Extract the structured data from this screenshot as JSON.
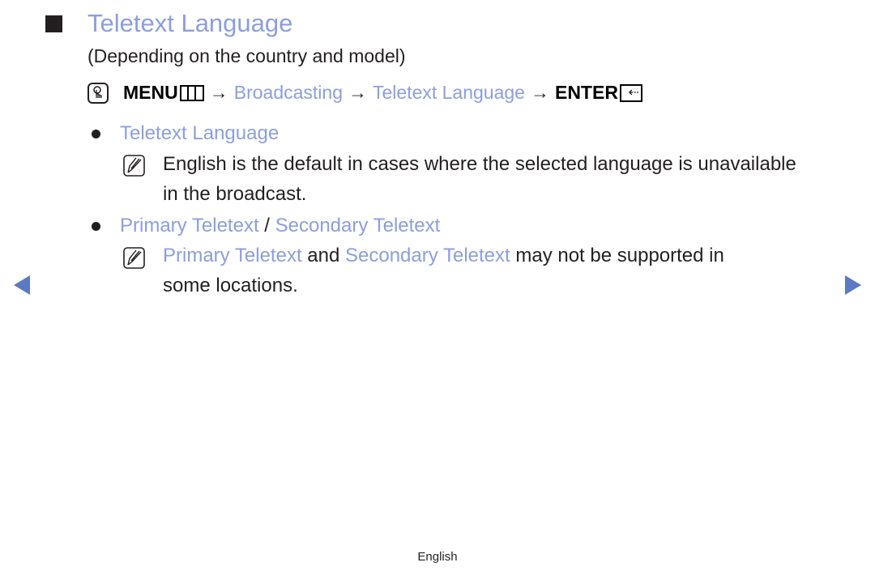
{
  "header": {
    "title": "Teletext Language",
    "subtitle": "(Depending on the country and model)"
  },
  "menu_path": {
    "ok_icon": "ok-hand-icon",
    "menu_label": "MENU",
    "menu_icon": "menu-grid-icon",
    "arrow": "→",
    "step1": "Broadcasting",
    "step2": "Teletext Language",
    "enter_label": "ENTER",
    "enter_icon": "enter-return-icon",
    "enter_glyph": "⇠"
  },
  "sections": [
    {
      "heading": "Teletext Language",
      "note_icon": "note-pencil-icon",
      "note_line1": "English is the default in cases where the selected language is unavailable",
      "note_line2": "in the broadcast."
    },
    {
      "heading_a": "Primary Teletext",
      "separator": " / ",
      "heading_b": "Secondary Teletext",
      "note_icon": "note-pencil-icon",
      "note_link_a": "Primary Teletext",
      "note_and": " and ",
      "note_link_b": "Secondary Teletext",
      "note_rest": " may not be supported in",
      "note_line2": "some locations."
    }
  ],
  "navigation": {
    "prev_icon": "previous-page-arrow-icon",
    "next_icon": "next-page-arrow-icon"
  },
  "footer": {
    "language": "English"
  },
  "colors": {
    "link": "#8c9ee0",
    "text": "#231f20",
    "nav_arrow": "#5b79c4"
  }
}
